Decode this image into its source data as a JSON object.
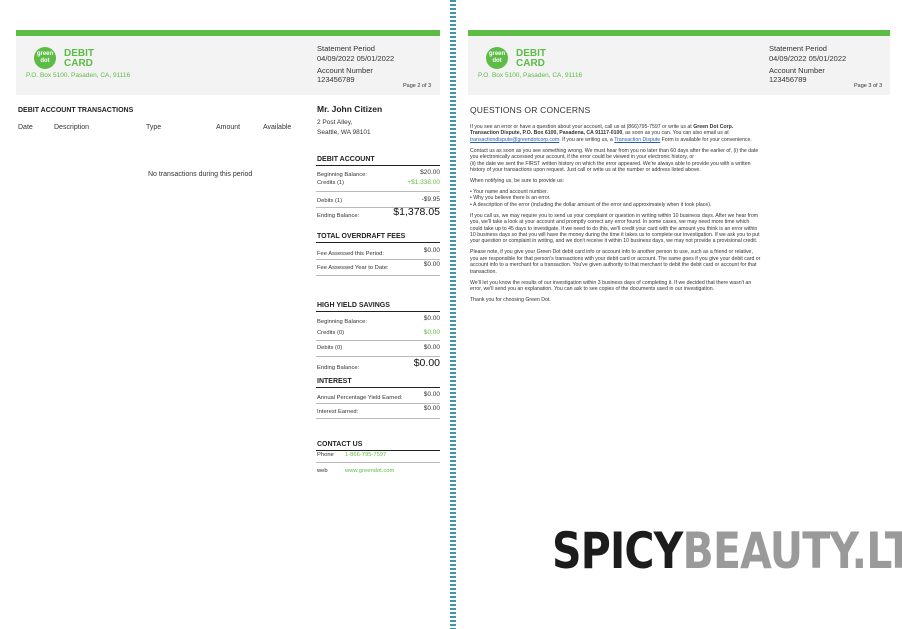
{
  "brand": {
    "logo_text": "green dot",
    "line1": "DEBIT",
    "line2": "CARD",
    "address": "P.O. Box 5100, Pasaden, CA, 91116"
  },
  "statement": {
    "period_label": "Statement Period",
    "period_value": "04/09/2022 05/01/2022",
    "account_label": "Account Number",
    "account_value": "123456789"
  },
  "page_left": {
    "page_number": "Page 2 of 3",
    "transactions_title": "DEBIT ACCOUNT TRANSACTIONS",
    "columns": [
      "Date",
      "Description",
      "Type",
      "Amount",
      "Available"
    ],
    "empty_message": "No transactions during this period",
    "customer": {
      "name": "Mr. John Citizen",
      "street": "2 Post Alley,",
      "city": "Seattle, WA 98101"
    },
    "debit": {
      "title": "DEBIT ACCOUNT",
      "beginning_label": "Beginning Balance:",
      "beginning_value": "$20.00",
      "credits_label": "Credits (1)",
      "credits_value": "+$1,338.00",
      "debits_label": "Debits (1)",
      "debits_value": "-$9.95",
      "ending_label": "Ending Balance:",
      "ending_value": "$1,378.05"
    },
    "overdraft": {
      "title": "TOTAL OVERDRAFT FEES",
      "period_label": "Fee Assessed this Period:",
      "period_value": "$0.00",
      "year_label": "Fee Assessed Year to Date:",
      "year_value": "$0.00"
    },
    "savings": {
      "title": "HIGH YIELD SAVINGS",
      "beginning_label": "Beginning Balance:",
      "beginning_value": "$0.00",
      "credits_label": "Credits (0)",
      "credits_value": "$0.00",
      "debits_label": "Debits (0)",
      "debits_value": "$0.00",
      "ending_label": "Ending Balance:",
      "ending_value": "$0.00"
    },
    "interest": {
      "title": "INTEREST",
      "apy_label": "Annual Percentage Yield Earned:",
      "apy_value": "$0.00",
      "earned_label": "Interest Earned:",
      "earned_value": "$0.00"
    },
    "contact": {
      "title": "CONTACT US",
      "phone_label": "Phone",
      "phone_value": "1-866-795-7597",
      "web_label": "web",
      "web_value": "www.greendot.com"
    }
  },
  "page_right": {
    "page_number": "Page 3 of 3",
    "title": "QUESTIONS OR CONCERNS",
    "p1_a": "If you see an error or have a question about your account, call us at (866)795-7597 or write us at",
    "p1_bold": "Green Dot Corp.  Transaction Dispute, P.O. Box 6100, Pasadena, CA 91117-0100",
    "p1_b": ", as soon as you can. You can also email us at",
    "p1_email": "transactiondispute@greendotcorp.com",
    "p1_c": ". If you are writing us, a",
    "p1_link": "Transaction Dispute",
    "p1_d": "Form is available for your convenience.",
    "p2": "Contact us as soon as you see something wrong. We must hear from you no later than 60 days after the earlier of, (i) the date you electronically  accessed your account, if the error could be viewed in your electronic history, or",
    "p2b": "(ii) the date we sent the FIRST written history on which the error appeared.  We're always able to provide you with a written history of your transactions upon request.  Just call or write us at the number or address listed above.",
    "p3": "When notifying us, be sure to provide us:",
    "bullets": [
      "Your name and account number.",
      "Why you believe  there is an error.",
      "A description of the error (including  the dollar amount  of the error and approximately  when it took place)."
    ],
    "p4": "If you call us, we may require you to send us your complaint  or question in writing within 10 business days. After we hear from you, we'll take a look at your account and promptly correct any error found. In some cases, we may need more time which could take up to 45 days to investigate. If we need to do this, we'll credit  your card with the amount you think is an error within 10 business days so that you will have the money during the time it takes us to complete our investigation. If we ask you to put your question or complaint  in writing, and we don't receive it within 10 business days, we may not provide  a provisional credit.",
    "p5": "Please note, if you give your Green Dot debit card info or account info to another person to use, such as a friend or relative, you are responsible  for that person's transactions with your debit card or account. The same goes if you give your debit card or account info to a merchant for a transaction. You've given authority to that merchant  to debit the debit card or account for that transaction.",
    "p6": "We'll let you know the results of our investigation within 3 business days of completing it. If we decided that there wasn't an error, we'll send you an explanation.  You can ask to see copies of the documents used in our investigation.",
    "p7": "Thank you for choosing Green Dot."
  },
  "watermark": {
    "part1": "SPICY",
    "part2": "BEAUTY.LT"
  }
}
